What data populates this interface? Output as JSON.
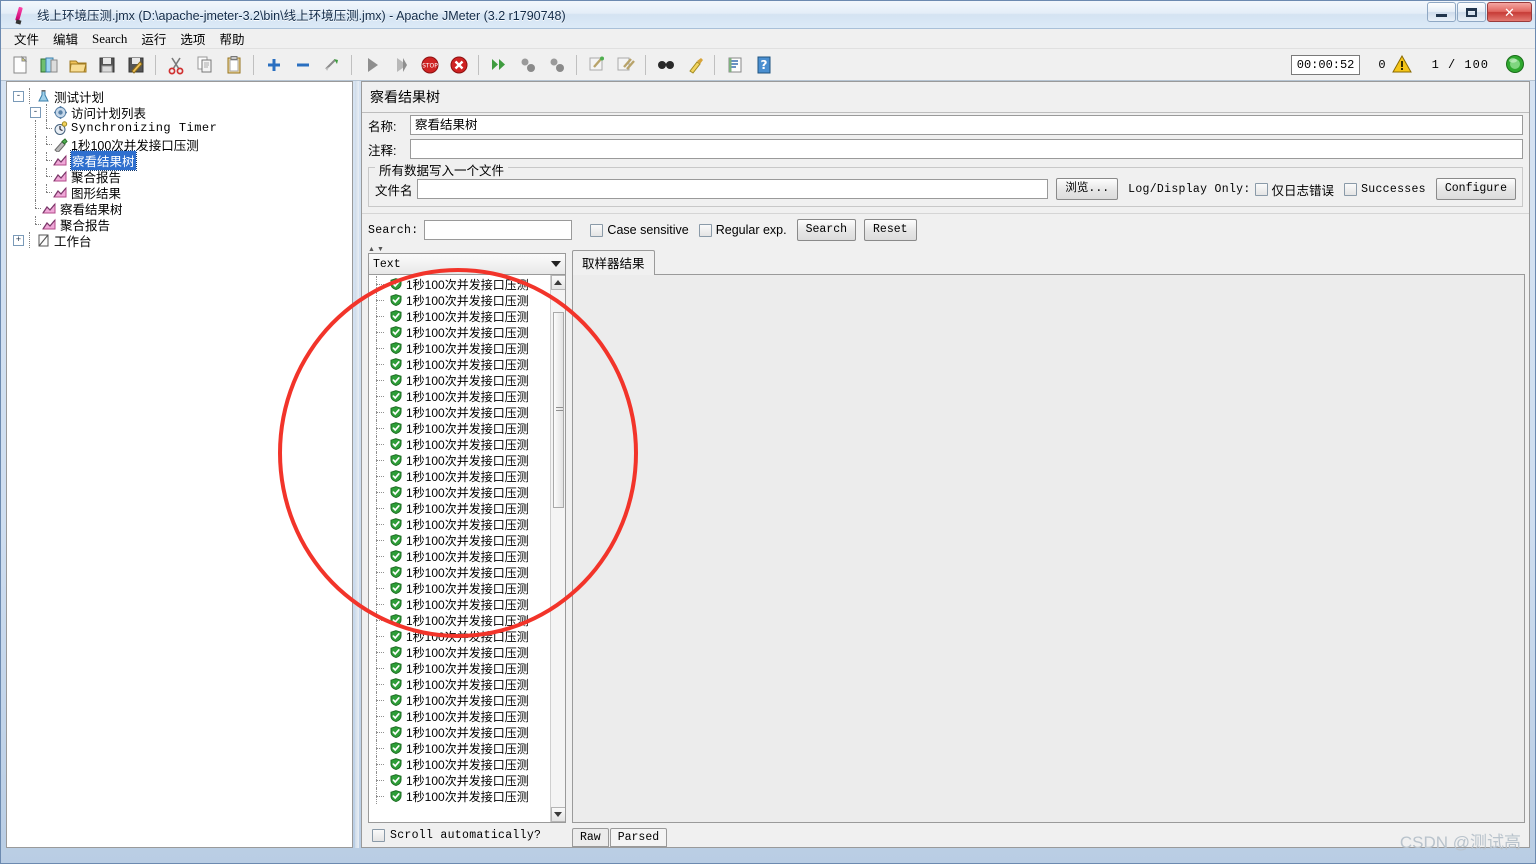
{
  "window": {
    "title": "线上环境压测.jmx (D:\\apache-jmeter-3.2\\bin\\线上环境压测.jmx) - Apache JMeter (3.2 r1790748)",
    "app_icon": "jmeter-feather-icon",
    "controls": {
      "minimize": "–",
      "maximize": "□",
      "close": "✕"
    }
  },
  "menubar": [
    {
      "label": "文件",
      "name": "menu-file"
    },
    {
      "label": "编辑",
      "name": "menu-edit"
    },
    {
      "label": "Search",
      "name": "menu-search"
    },
    {
      "label": "运行",
      "name": "menu-run"
    },
    {
      "label": "选项",
      "name": "menu-options"
    },
    {
      "label": "帮助",
      "name": "menu-help"
    }
  ],
  "toolbar": {
    "buttons": [
      "new-icon",
      "templates-icon",
      "open-icon",
      "save-icon",
      "save-as-icon",
      "cut-icon",
      "copy-icon",
      "paste-icon",
      "expand-icon",
      "collapse-icon",
      "toggle-icon",
      "start-icon",
      "start-no-timers-icon",
      "stop-icon",
      "shutdown-icon",
      "remote-start-all-icon",
      "remote-stop-all-icon",
      "remote-shutdown-all-icon",
      "clear-icon",
      "clear-all-icon",
      "search-icon",
      "search-reset-icon",
      "function-helper-icon",
      "help-icon"
    ],
    "elapsed_time": "00:00:52",
    "warning_count": "0",
    "warning_icon": "warning-triangle-icon",
    "thread_count": "1 / 100",
    "run_indicator": "running-green-circle-icon"
  },
  "tree": {
    "nodes": [
      {
        "label": "测试计划",
        "icon": "test-plan-icon",
        "depth": 0,
        "expander": "-",
        "selected": false,
        "mono": false
      },
      {
        "label": "访问计划列表",
        "icon": "thread-group-icon",
        "depth": 1,
        "expander": "-",
        "selected": false,
        "mono": false
      },
      {
        "label": "Synchronizing Timer",
        "icon": "timer-icon",
        "depth": 2,
        "expander": "",
        "selected": false,
        "mono": true
      },
      {
        "label": "1秒100次并发接口压测",
        "icon": "http-sampler-icon",
        "depth": 2,
        "expander": "",
        "selected": false,
        "mono": false
      },
      {
        "label": "察看结果树",
        "icon": "listener-icon",
        "depth": 2,
        "expander": "",
        "selected": true,
        "mono": false
      },
      {
        "label": "聚合报告",
        "icon": "listener-icon",
        "depth": 2,
        "expander": "",
        "selected": false,
        "mono": false
      },
      {
        "label": "图形结果",
        "icon": "listener-icon",
        "depth": 2,
        "expander": "",
        "selected": false,
        "mono": false
      },
      {
        "label": "察看结果树",
        "icon": "listener-icon",
        "depth": 1,
        "expander": "",
        "selected": false,
        "mono": false
      },
      {
        "label": "聚合报告",
        "icon": "listener-icon",
        "depth": 1,
        "expander": "",
        "selected": false,
        "mono": false
      },
      {
        "label": "工作台",
        "icon": "workbench-icon",
        "depth": 0,
        "expander": "+",
        "selected": false,
        "mono": false
      }
    ]
  },
  "right_panel": {
    "title": "察看结果树",
    "name_label": "名称:",
    "name_value": "察看结果树",
    "comment_label": "注释:",
    "comment_value": "",
    "filesave": {
      "group_title": "所有数据写入一个文件",
      "filename_label": "文件名",
      "filename_value": "",
      "browse_button": "浏览...",
      "log_display_label": "Log/Display Only:",
      "errors_only_label": "仅日志错误",
      "successes_label": "Successes",
      "configure_button": "Configure"
    },
    "search": {
      "label": "Search:",
      "value": "",
      "case_sensitive_label": "Case sensitive",
      "regular_exp_label": "Regular exp.",
      "search_button": "Search",
      "reset_button": "Reset"
    },
    "results": {
      "renderer_selected": "Text",
      "sample_label": "1秒100次并发接口压测",
      "sample_icon": "success-shield-icon",
      "row_count": 33,
      "scroll_auto_label": "Scroll automatically?"
    },
    "detail": {
      "tabs": [
        {
          "label": "取样器结果",
          "active": true
        }
      ],
      "body_text": "",
      "bottom_tabs": [
        {
          "label": "Raw",
          "active": false
        },
        {
          "label": "Parsed",
          "active": true
        }
      ]
    }
  },
  "annotation": {
    "shape": "red-circle-highlight"
  },
  "watermark": "CSDN @测试高",
  "colors": {
    "accent_blue": "#2f6fce",
    "annotation_red": "#f2342a",
    "success_green": "#2e9e38",
    "panel_bg": "#f0f0f0",
    "frame_blue": "#9db6d0"
  }
}
